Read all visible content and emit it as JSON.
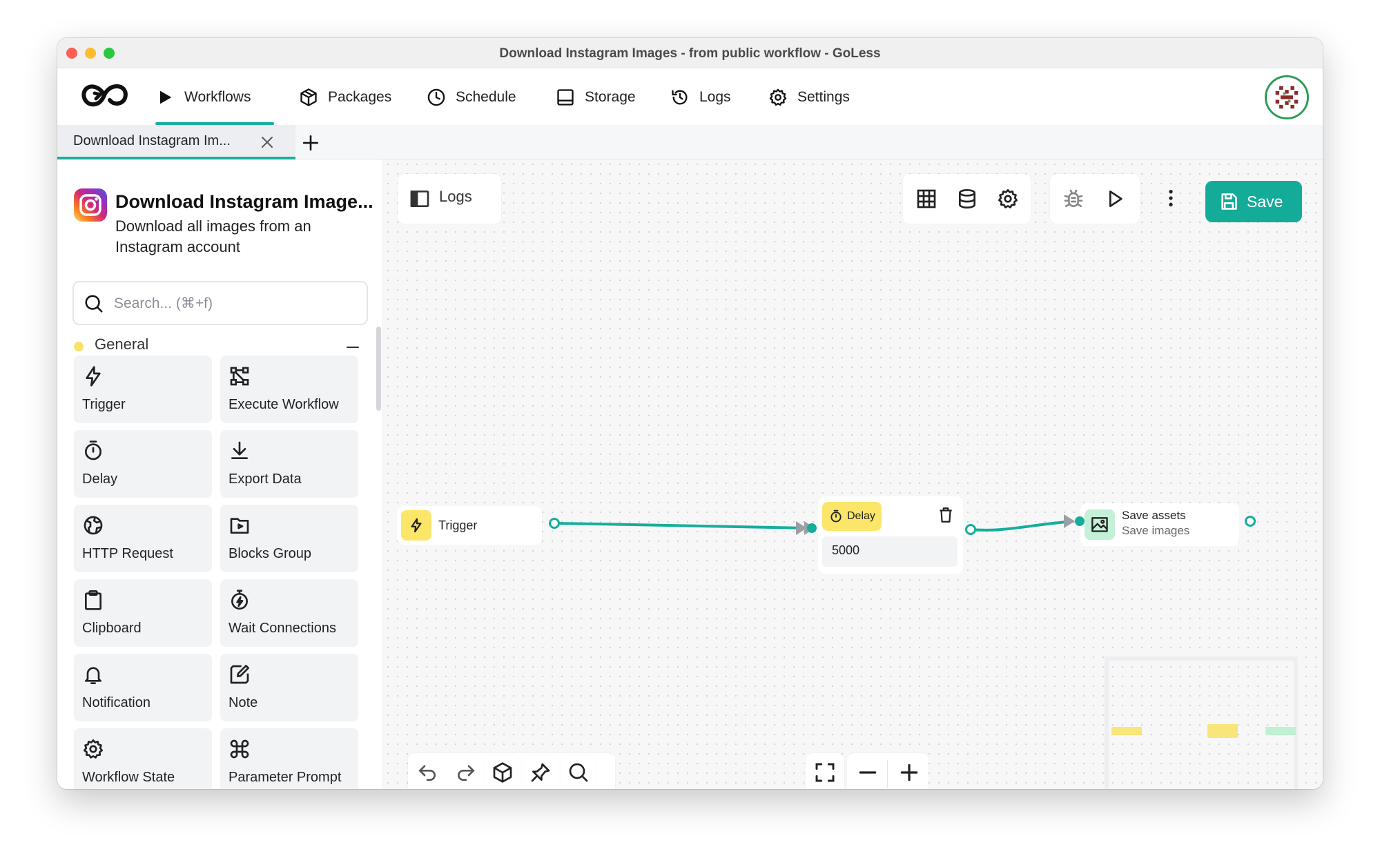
{
  "window": {
    "title": "Download Instagram Images - from public workflow - GoLess"
  },
  "nav": {
    "items": [
      {
        "label": "Workflows",
        "icon": "play-icon"
      },
      {
        "label": "Packages",
        "icon": "package-icon"
      },
      {
        "label": "Schedule",
        "icon": "clock-icon"
      },
      {
        "label": "Storage",
        "icon": "storage-icon"
      },
      {
        "label": "Logs",
        "icon": "history-icon"
      },
      {
        "label": "Settings",
        "icon": "gear-icon"
      }
    ],
    "active": "Workflows"
  },
  "tabs": [
    {
      "label": "Download Instagram Im..."
    }
  ],
  "sidebar": {
    "workflow_title": "Download Instagram Image...",
    "workflow_description": "Download all images from an Instagram account",
    "search_placeholder": "Search... (⌘+f)",
    "group": {
      "label": "General",
      "color": "#f7e36b"
    },
    "blocks": [
      {
        "label": "Trigger",
        "icon": "lightning-icon"
      },
      {
        "label": "Execute Workflow",
        "icon": "flow-icon"
      },
      {
        "label": "Delay",
        "icon": "timer-icon"
      },
      {
        "label": "Export Data",
        "icon": "download-icon"
      },
      {
        "label": "HTTP Request",
        "icon": "globe-icon"
      },
      {
        "label": "Blocks Group",
        "icon": "folder-icon"
      },
      {
        "label": "Clipboard",
        "icon": "clipboard-icon"
      },
      {
        "label": "Wait Connections",
        "icon": "stopwatch-icon"
      },
      {
        "label": "Notification",
        "icon": "bell-icon"
      },
      {
        "label": "Note",
        "icon": "note-icon"
      },
      {
        "label": "Workflow State",
        "icon": "gear-icon"
      },
      {
        "label": "Parameter Prompt",
        "icon": "command-icon"
      }
    ]
  },
  "editor": {
    "logs_label": "Logs",
    "save_label": "Save",
    "accent": "#15ab99",
    "nodes": {
      "trigger": {
        "label": "Trigger",
        "color": "#fbe66a"
      },
      "delay": {
        "label": "Delay",
        "value": "5000",
        "color": "#fbe66a"
      },
      "save_assets": {
        "title": "Save assets",
        "subtitle": "Save images",
        "color": "#c4f0d8"
      }
    }
  }
}
